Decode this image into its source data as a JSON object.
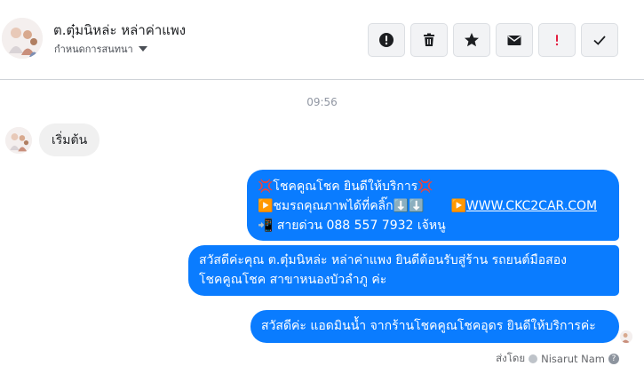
{
  "header": {
    "contact_name": "ต.ตุ๋มนิหล่ะ หล่าค่าแพง",
    "manage_label": "กำหนดการสนทนา"
  },
  "actions": [
    {
      "name": "report-button",
      "icon": "exclamation-circle-icon"
    },
    {
      "name": "delete-button",
      "icon": "trash-icon"
    },
    {
      "name": "star-button",
      "icon": "star-icon"
    },
    {
      "name": "mark-unread-button",
      "icon": "envelope-icon"
    },
    {
      "name": "flag-button",
      "icon": "red-exclamation-icon"
    },
    {
      "name": "done-button",
      "icon": "checkmark-icon"
    }
  ],
  "colors": {
    "outgoing_bubble": "#0a7cff",
    "incoming_bubble": "#f0f0f0",
    "flag_red": "#e41e3f"
  },
  "conversation": {
    "timestamp": "09:56",
    "incoming": [
      {
        "text": "เริ่มต้น"
      }
    ],
    "outgoing": {
      "msg1": {
        "line1": "💢โชคคูณโชค ยินดีให้บริการ💢",
        "line2a": "▶️ชมรถคุณภาพได้ที่คลิ๊ก⬇️⬇️",
        "line2b": "▶️",
        "link": "WWW.CKC2CAR.COM",
        "line3": "📲 สายด่วน 088 557 7932 เจ้หนู"
      },
      "msg2": {
        "line1": "สวัสดีค่ะคุณ ต.ตุ๋มนิหล่ะ หล่าค่าแพง ยินดีต้อนรับสู่ร้าน รถยนต์มือสอง",
        "line2": "โชคคูณโชค สาขาหนองบัวลำภู ค่ะ"
      },
      "msg3": {
        "line1": "สวัสดีค่ะ แอดมินน้ำ จากร้านโชคคูณโชคอุดร ยินดีให้บริการค่ะ"
      }
    },
    "sent_by": {
      "prefix": "ส่งโดย",
      "name": "Nisarut Nam"
    }
  }
}
